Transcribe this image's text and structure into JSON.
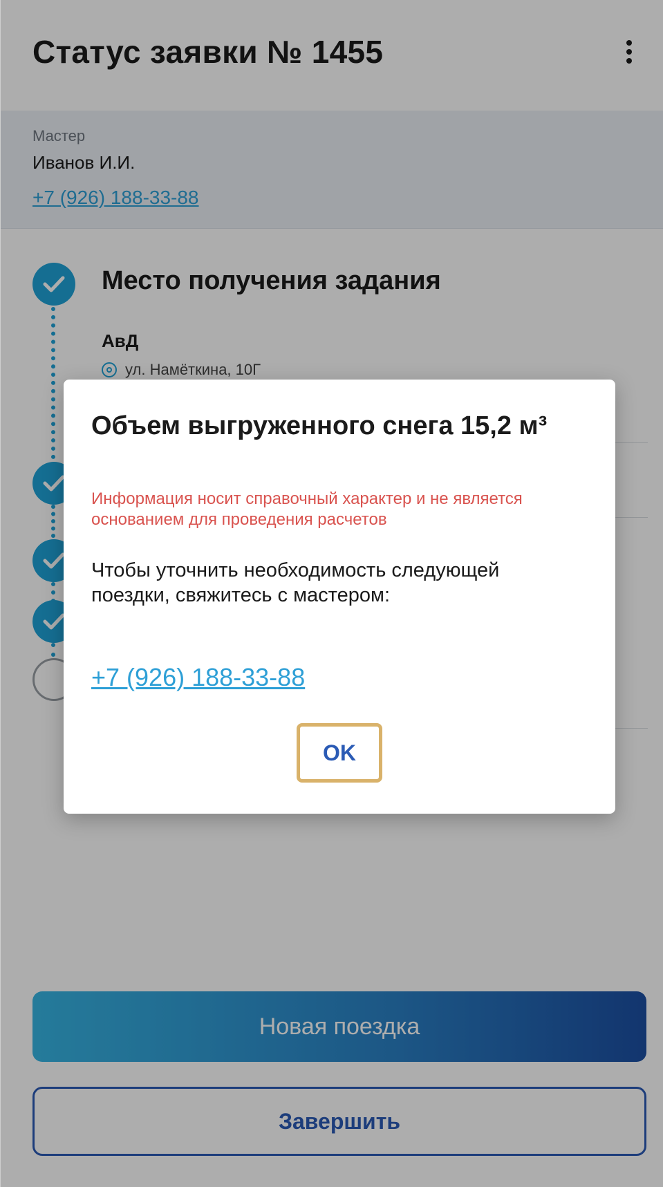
{
  "header": {
    "title": "Статус заявки № 1455",
    "menu_icon": "more-vertical-icon"
  },
  "master": {
    "label": "Мастер",
    "name": "Иванов И.И.",
    "phone": "+7 (926) 188-33-88"
  },
  "timeline": {
    "step1": {
      "title": "Место получения задания",
      "place_name": "АвД",
      "address": "ул. Намёткина, 10Г",
      "status": "done"
    },
    "steps_status": [
      "done",
      "done",
      "done",
      "done",
      "pending"
    ]
  },
  "actions": {
    "new_trip": "Новая поездка",
    "finish": "Завершить"
  },
  "dialog": {
    "title": "Объем выгруженного снега 15,2 м³",
    "warning": "Информация носит справочный характер и не является основанием для проведения расчетов",
    "body": "Чтобы уточнить необходимость следующей поездки, свяжитесь с мастером:",
    "phone": "+7 (926) 188-33-88",
    "ok": "OK"
  },
  "colors": {
    "accent": "#1fa3d8",
    "primary_dark": "#2b5bb5",
    "warning": "#d9534f",
    "highlight": "#d9b26a"
  }
}
